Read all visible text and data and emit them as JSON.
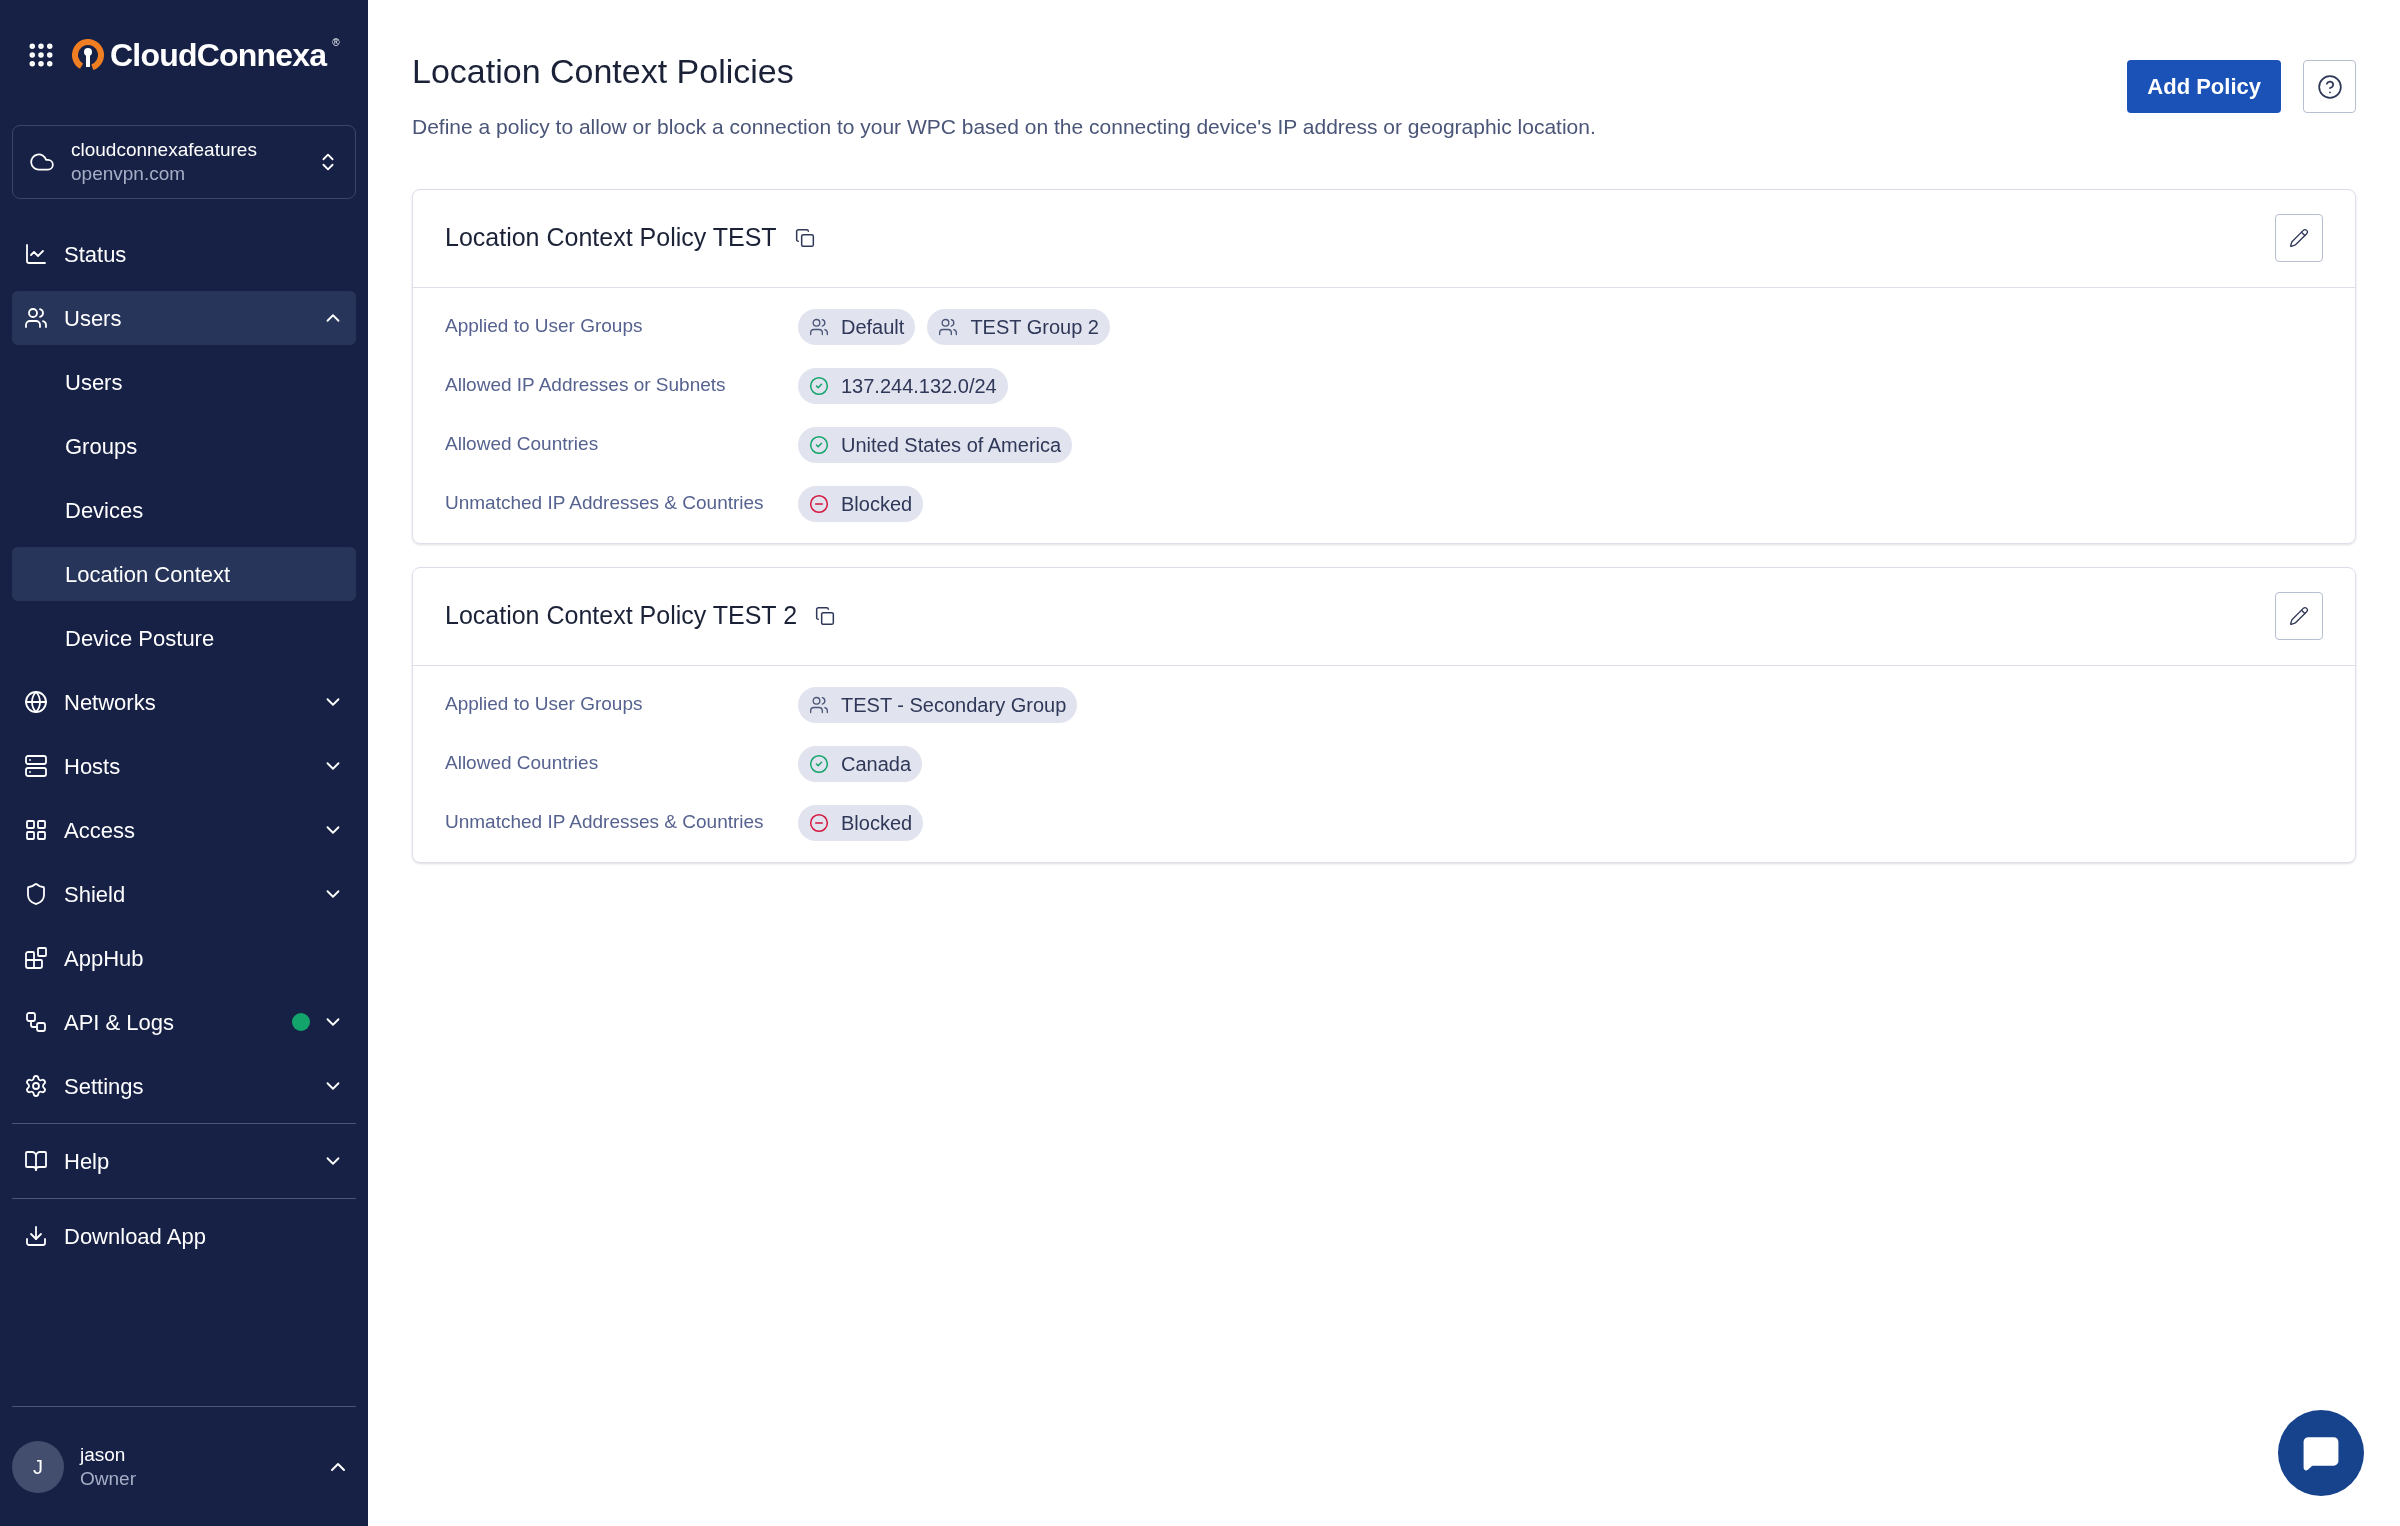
{
  "sidebar": {
    "logo": {
      "name": "CloudConnexa",
      "mark": "®"
    },
    "workspace": {
      "name": "cloudconnexafeatures",
      "domain": "openvpn.com"
    },
    "sections": [
      {
        "items": [
          {
            "label": "Status",
            "selected": false
          },
          {
            "label": "Users",
            "selected": true,
            "expanded": true,
            "children": [
              {
                "label": "Users",
                "selected": false
              },
              {
                "label": "Groups",
                "selected": false
              },
              {
                "label": "Devices",
                "selected": false
              },
              {
                "label": "Location Context",
                "selected": true
              },
              {
                "label": "Device Posture",
                "selected": false
              }
            ]
          },
          {
            "label": "Networks",
            "selected": false,
            "expanded": false
          },
          {
            "label": "Hosts",
            "selected": false,
            "expanded": false
          },
          {
            "label": "Access",
            "selected": false,
            "expanded": false
          },
          {
            "label": "Shield",
            "selected": false,
            "expanded": false
          },
          {
            "label": "AppHub",
            "selected": false
          },
          {
            "label": "API & Logs",
            "selected": false,
            "expanded": false,
            "color": "#12a46a"
          },
          {
            "label": "Settings",
            "selected": false,
            "expanded": false
          }
        ]
      },
      {
        "items": [
          {
            "label": "Help",
            "selected": false,
            "expanded": false
          }
        ]
      },
      {
        "items": [
          {
            "label": "Download App",
            "selected": false
          }
        ]
      }
    ],
    "user": {
      "initial": "J",
      "name": "jason",
      "role": "Owner"
    }
  },
  "main": {
    "title": "Location Context Policies",
    "description": "Define a policy to allow or block a connection to your WPC based on the connecting device's IP address or geographic location.",
    "add_button": "Add Policy",
    "policies": [
      {
        "name": "Location Context Policy TEST",
        "rows": [
          {
            "label": "Applied to User Groups",
            "chips": [
              {
                "kind": "group",
                "text": "Default"
              },
              {
                "kind": "group",
                "text": "TEST Group 2"
              }
            ]
          },
          {
            "label": "Allowed IP Addresses or Subnets",
            "chips": [
              {
                "kind": "allowed",
                "text": "137.244.132.0/24"
              }
            ]
          },
          {
            "label": "Allowed Countries",
            "chips": [
              {
                "kind": "allowed",
                "text": "United States of America"
              }
            ]
          },
          {
            "label": "Unmatched IP Addresses & Countries",
            "chips": [
              {
                "kind": "blocked",
                "text": "Blocked"
              }
            ]
          }
        ]
      },
      {
        "name": "Location Context Policy TEST 2",
        "rows": [
          {
            "label": "Applied to User Groups",
            "chips": [
              {
                "kind": "group",
                "text": "TEST - Secondary Group"
              }
            ]
          },
          {
            "label": "Allowed Countries",
            "chips": [
              {
                "kind": "allowed",
                "text": "Canada"
              }
            ]
          },
          {
            "label": "Unmatched IP Addresses & Countries",
            "chips": [
              {
                "kind": "blocked",
                "text": "Blocked"
              }
            ]
          }
        ]
      }
    ]
  }
}
